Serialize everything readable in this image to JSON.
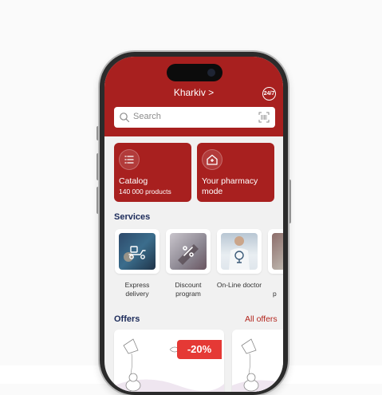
{
  "header": {
    "city_label": "Kharkiv >",
    "badge_247": "24/7"
  },
  "search": {
    "placeholder": "Search"
  },
  "cards": [
    {
      "title": "Catalog",
      "subtitle": "140 000 products",
      "icon": "list-icon"
    },
    {
      "title": "Your pharmacy mode",
      "subtitle": "",
      "icon": "pharmacy-house-icon"
    }
  ],
  "services": {
    "title": "Services",
    "items": [
      {
        "label": "Express delivery",
        "icon": "delivery-scooter-icon"
      },
      {
        "label": "Discount program",
        "icon": "percent-icon"
      },
      {
        "label": "On-Line doctor",
        "icon": "doctor-icon"
      },
      {
        "label": "p",
        "icon": "service-icon"
      }
    ]
  },
  "offers": {
    "title": "Offers",
    "all_label": "All offers",
    "discount": "-20%"
  },
  "colors": {
    "brand_red": "#a8201f",
    "navy": "#1c2b5a",
    "discount_red": "#e53935"
  }
}
